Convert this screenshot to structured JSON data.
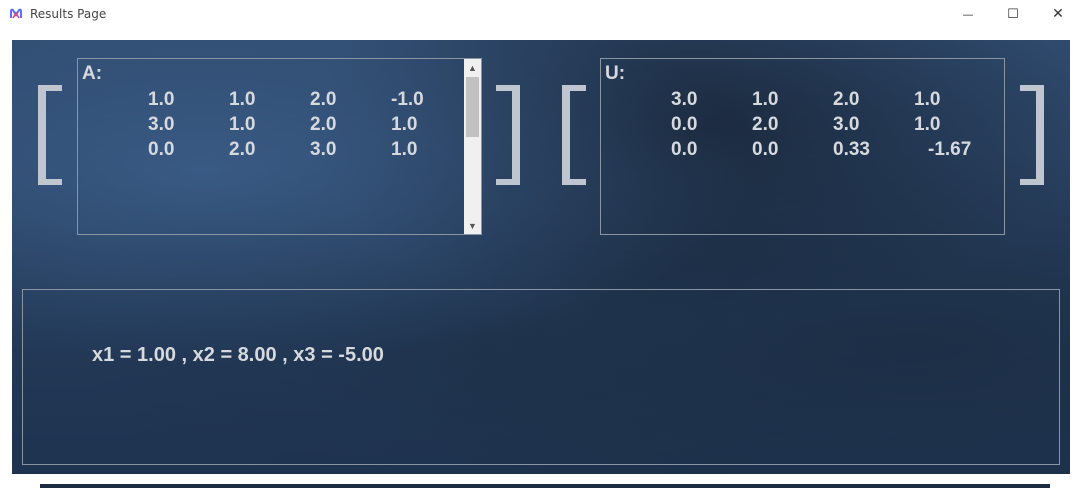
{
  "window": {
    "title": "Results Page",
    "minimize_glyph": "—",
    "maximize_glyph": "☐",
    "close_glyph": "✕",
    "icon": "app-logo-icon"
  },
  "matrix_a": {
    "label": "A:",
    "rows": [
      [
        "1.0",
        "1.0",
        "2.0",
        "-1.0"
      ],
      [
        "3.0",
        "1.0",
        "2.0",
        "1.0"
      ],
      [
        "0.0",
        "2.0",
        "3.0",
        "1.0"
      ]
    ],
    "scroll_up_glyph": "▲",
    "scroll_down_glyph": "▼"
  },
  "matrix_u": {
    "label": "U:",
    "rows": [
      [
        "3.0",
        "1.0",
        "2.0",
        "1.0"
      ],
      [
        "0.0",
        "2.0",
        "3.0",
        "1.0"
      ],
      [
        "0.0",
        "0.0",
        "0.33",
        "-1.67"
      ]
    ]
  },
  "result": {
    "text": "x1 = 1.00 , x2 = 8.00 , x3 = -5.00"
  },
  "colors": {
    "background": "#2a4264",
    "text": "#d6d9de",
    "bracket": "#c0c6cf"
  }
}
